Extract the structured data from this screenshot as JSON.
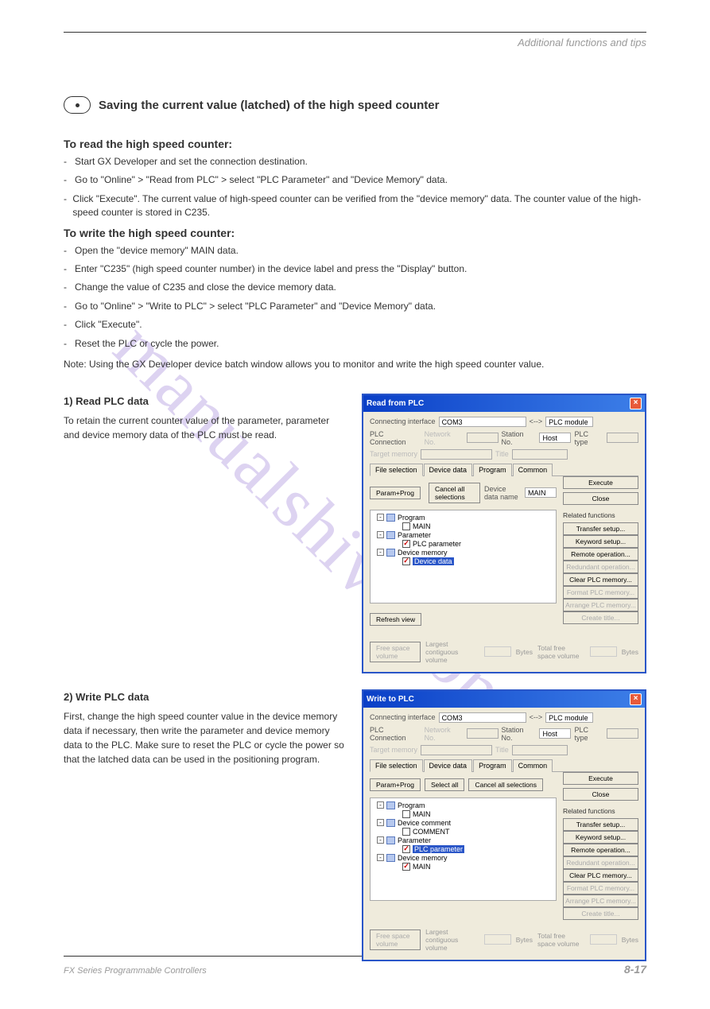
{
  "header_right": "Additional functions and tips",
  "tip_title": "Saving the current value (latched) of the high speed counter",
  "sections": [
    {
      "title": "To read the high speed counter:",
      "items": [
        "Start GX Developer and set the connection destination.",
        "Go to \"Online\" > \"Read from PLC\" > select \"PLC Parameter\" and \"Device Memory\" data.",
        "Click \"Execute\".  The current value of high-speed counter can be verified from the \"device memory\" data. The counter value of the high-speed counter is stored in C235."
      ]
    },
    {
      "title": "To write the high speed counter:",
      "items": [
        "Open the \"device memory\" MAIN data.",
        "Enter \"C235\" (high speed counter number) in the device label and press the \"Display\" button.",
        "Change the value of C235 and close the device memory data.",
        "Go to \"Online\" > \"Write to PLC\" > select \"PLC Parameter\" and \"Device Memory\" data.",
        "Click \"Execute\".",
        "Reset the PLC or cycle the power."
      ]
    }
  ],
  "note_text": "Note: Using the GX Developer device batch window allows you to monitor and write the high speed counter value.",
  "left_blocks": [
    {
      "title": "1) Read PLC data",
      "body": "To retain the current counter value of the parameter, parameter and device memory data of the PLC must be read."
    },
    {
      "title": "2) Write PLC data",
      "body": "First, change the high speed counter value in the device memory data if necessary, then write the parameter and device memory data to the PLC. Make sure to reset the PLC or cycle the power so that the latched data can be used in the positioning program."
    }
  ],
  "dialogs": {
    "read": {
      "title": "Read from PLC",
      "connecting_label": "Connecting interface",
      "connecting_value": "COM3",
      "module_label": "PLC module",
      "plc_conn_label": "PLC Connection",
      "network_label": "Network No.",
      "station_label": "Station No.",
      "station_value": "Host",
      "plctype_label": "PLC type",
      "target_label": "Target memory",
      "title_field_label": "Title",
      "tabs": [
        "File selection",
        "Device data",
        "Program",
        "Common"
      ],
      "button_row": {
        "paramprog": "Param+Prog",
        "cancel": "Cancel all selections",
        "devname_label": "Device data name",
        "devname_value": "MAIN"
      },
      "tree": [
        {
          "type": "branch",
          "expand": "-",
          "icon": "b",
          "label": "Program"
        },
        {
          "type": "leaf",
          "indent": 2,
          "checked": false,
          "label": "MAIN"
        },
        {
          "type": "branch",
          "expand": "-",
          "icon": "b",
          "label": "Parameter"
        },
        {
          "type": "leaf",
          "indent": 2,
          "checked": true,
          "label": "PLC parameter"
        },
        {
          "type": "branch",
          "expand": "-",
          "icon": "b",
          "label": "Device memory"
        },
        {
          "type": "leaf",
          "indent": 2,
          "checked": true,
          "selected": true,
          "label": "Device data"
        }
      ],
      "refresh": "Refresh view",
      "right": {
        "execute": "Execute",
        "close": "Close",
        "group": "Related functions",
        "buttons": [
          "Transfer setup...",
          "Keyword setup...",
          "Remote operation...",
          "Redundant operation...",
          "Clear PLC memory...",
          "Format PLC memory...",
          "Arrange PLC memory...",
          "Create title..."
        ],
        "disabled": [
          3,
          5,
          6,
          7
        ]
      },
      "footer": {
        "free": "Free space volume",
        "largest": "Largest contiguous volume",
        "bytes1": "Bytes",
        "total": "Total free space volume",
        "bytes2": "Bytes"
      }
    },
    "write": {
      "title": "Write to PLC",
      "button_row": {
        "paramprog": "Param+Prog",
        "selectall": "Select all",
        "cancel": "Cancel all selections"
      },
      "tree": [
        {
          "type": "branch",
          "expand": "-",
          "icon": "b",
          "label": "Program"
        },
        {
          "type": "leaf",
          "indent": 2,
          "checked": false,
          "label": "MAIN"
        },
        {
          "type": "branch",
          "expand": "-",
          "icon": "b",
          "label": "Device comment"
        },
        {
          "type": "leaf",
          "indent": 2,
          "checked": false,
          "label": "COMMENT"
        },
        {
          "type": "branch",
          "expand": "-",
          "icon": "b",
          "label": "Parameter"
        },
        {
          "type": "leaf",
          "indent": 2,
          "checked": true,
          "selected": true,
          "label": "PLC parameter"
        },
        {
          "type": "branch",
          "expand": "-",
          "icon": "b",
          "label": "Device memory"
        },
        {
          "type": "leaf",
          "indent": 2,
          "checked": true,
          "label": "MAIN"
        }
      ]
    }
  },
  "watermark": "manualshive.com",
  "footer_left": "FX Series Programmable Controllers",
  "footer_right": "8-17"
}
